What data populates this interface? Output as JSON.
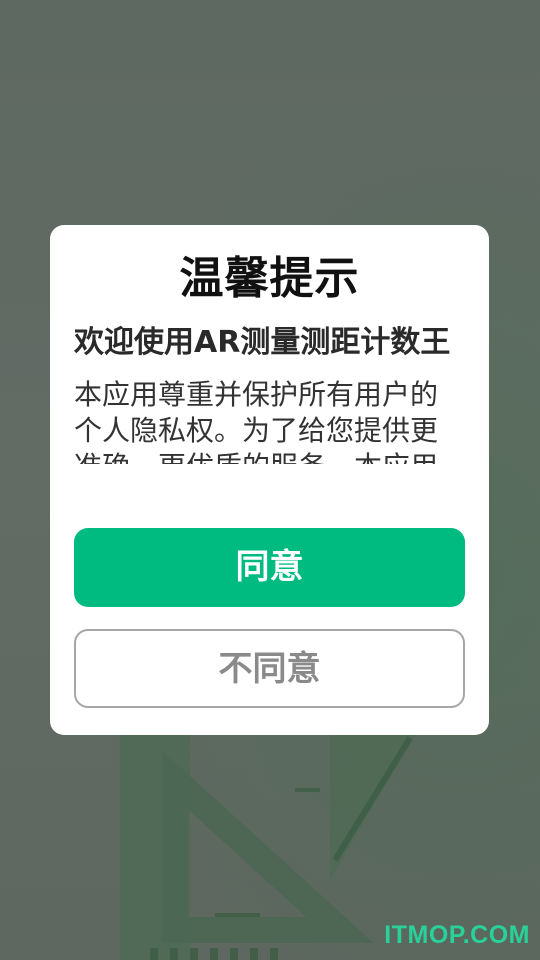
{
  "dialog": {
    "title": "温馨提示",
    "welcome": "欢迎使用AR测量测距计数王",
    "body": "本应用尊重并保护所有用户的个人隐私权。为了给您提供更准确、更优质的服务，本应用",
    "agree_label": "同意",
    "disagree_label": "不同意"
  },
  "watermark": "ITMOP.COM",
  "colors": {
    "accent": "#00bb80",
    "watermark": "#29d19a"
  }
}
